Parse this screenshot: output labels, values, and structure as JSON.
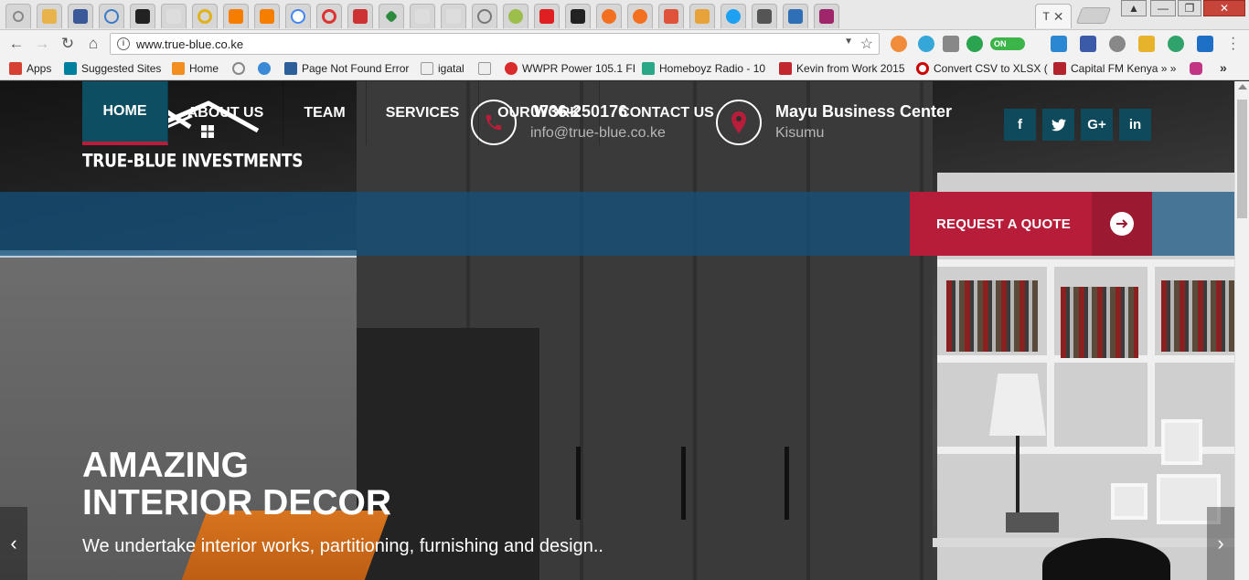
{
  "browser": {
    "active_tab_label": "T",
    "active_tab_close": "✕",
    "url": "www.true-blue.co.ke",
    "info_glyph": "i",
    "dropdown_glyph": "▼",
    "star_glyph": "☆",
    "back_glyph": "←",
    "forward_glyph": "→",
    "reload_glyph": "↻",
    "home_glyph": "⌂",
    "toggle_label": "ON",
    "window_min": "—",
    "window_max": "❐",
    "window_close": "✕",
    "bookmarks": [
      {
        "label": "Apps",
        "icon": "apps-grid-icon",
        "color": "#d64032"
      },
      {
        "label": "Suggested Sites",
        "icon": "bing-icon",
        "color": "#00809d"
      },
      {
        "label": "Home",
        "icon": "joomla-icon",
        "color": "#f28d20"
      },
      {
        "label": "",
        "icon": "loop-icon",
        "color": "#888888"
      },
      {
        "label": "",
        "icon": "m-icon",
        "color": "#3b8ad8"
      },
      {
        "label": "Page Not Found Error",
        "icon": "p-icon",
        "color": "#2d5f9a"
      },
      {
        "label": "igatal",
        "icon": "olx-icon",
        "color": "#5d5d5d"
      },
      {
        "label": "",
        "icon": "olx-icon-2",
        "color": "#5d5d5d"
      },
      {
        "label": "WWPR Power 105.1 FI",
        "icon": "wwpr-icon",
        "color": "#d92b2b"
      },
      {
        "label": "Homeboyz Radio - 10",
        "icon": "homeboyz-icon",
        "color": "#2aa886"
      },
      {
        "label": "Kevin from Work 2015",
        "icon": "ez-icon",
        "color": "#c1272d"
      },
      {
        "label": "Convert CSV to XLSX (",
        "icon": "no-icon",
        "color": "#cc0000"
      },
      {
        "label": "Capital FM Kenya » »",
        "icon": "capital-icon",
        "color": "#b3232e"
      },
      {
        "label": "",
        "icon": "instagram-icon",
        "color": "#c13584"
      }
    ],
    "bookmarks_more": "»"
  },
  "site": {
    "logo_text": "TRUE-BLUE INVESTMENTS",
    "phone": "0736-250176",
    "email": "info@true-blue.co.ke",
    "location_title": "Mayu Business Center",
    "location_city": "Kisumu",
    "social": [
      {
        "label": "f",
        "icon": "facebook-icon"
      },
      {
        "label": "🐦",
        "icon": "twitter-icon"
      },
      {
        "label": "G+",
        "icon": "google-plus-icon"
      },
      {
        "label": "in",
        "icon": "linkedin-icon"
      }
    ],
    "nav": [
      {
        "label": "HOME",
        "active": true
      },
      {
        "label": "ABOUT US",
        "active": false
      },
      {
        "label": "TEAM",
        "active": false
      },
      {
        "label": "SERVICES",
        "active": false
      },
      {
        "label": "OUR WORK",
        "active": false
      },
      {
        "label": "CONTACT US",
        "active": false
      }
    ],
    "quote_button": "REQUEST A QUOTE",
    "hero_title_line1": "AMAZING",
    "hero_title_line2": "INTERIOR DECOR",
    "hero_subtitle": "We undertake interior works, partitioning, furnishing and design..",
    "slider_prev": "‹",
    "slider_next": "›"
  },
  "colors": {
    "nav_bg": "#105280",
    "nav_active": "#0d4e62",
    "accent_red": "#b71c38",
    "social_bg": "#0e4a5c"
  }
}
